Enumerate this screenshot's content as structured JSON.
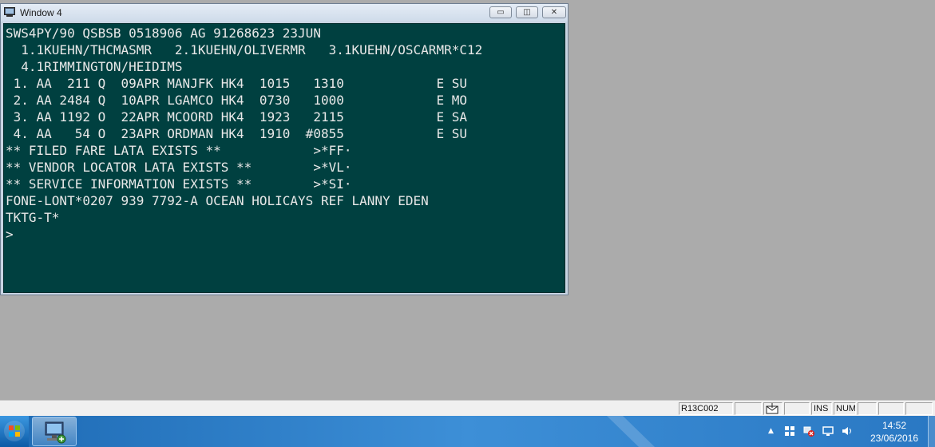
{
  "window": {
    "title": "Window 4",
    "min_glyph": "▭",
    "max_glyph": "◫",
    "close_glyph": "✕"
  },
  "terminal": {
    "lines": [
      "SWS4PY/90 QSBSB 0518906 AG 91268623 23JUN",
      "  1.1KUEHN/THCMASMR   2.1KUEHN/OLIVERMR   3.1KUEHN/OSCARMR*C12",
      "  4.1RIMMINGTON/HEIDIMS",
      " 1. AA  211 Q  09APR MANJFK HK4  1015   1310            E SU",
      " 2. AA 2484 Q  10APR LGAMCO HK4  0730   1000            E MO",
      " 3. AA 1192 O  22APR MCOORD HK4  1923   2115            E SA",
      " 4. AA   54 O  23APR ORDMAN HK4  1910  #0855            E SU",
      "** FILED FARE LATA EXISTS **            >*FF·",
      "** VENDOR LOCATOR LATA EXISTS **        >*VL·",
      "** SERVICE INFORMATION EXISTS **        >*SI·",
      "FONE-LONT*0207 939 7792-A OCEAN HOLICAYS REF LANNY EDEN",
      "TKTG-T*",
      ">"
    ]
  },
  "statusbar": {
    "cell1": "R13C002",
    "cell2": "",
    "mail_icon": "mail-icon",
    "cell4": "",
    "ins": "INS",
    "num": "NUM"
  },
  "taskbar": {
    "time": "14:52",
    "date": "23/06/2016",
    "tray_arrow": "▲"
  },
  "colors": {
    "desktop": "#ababab",
    "terminal_bg": "#004040",
    "terminal_fg": "#e8e8e8"
  }
}
